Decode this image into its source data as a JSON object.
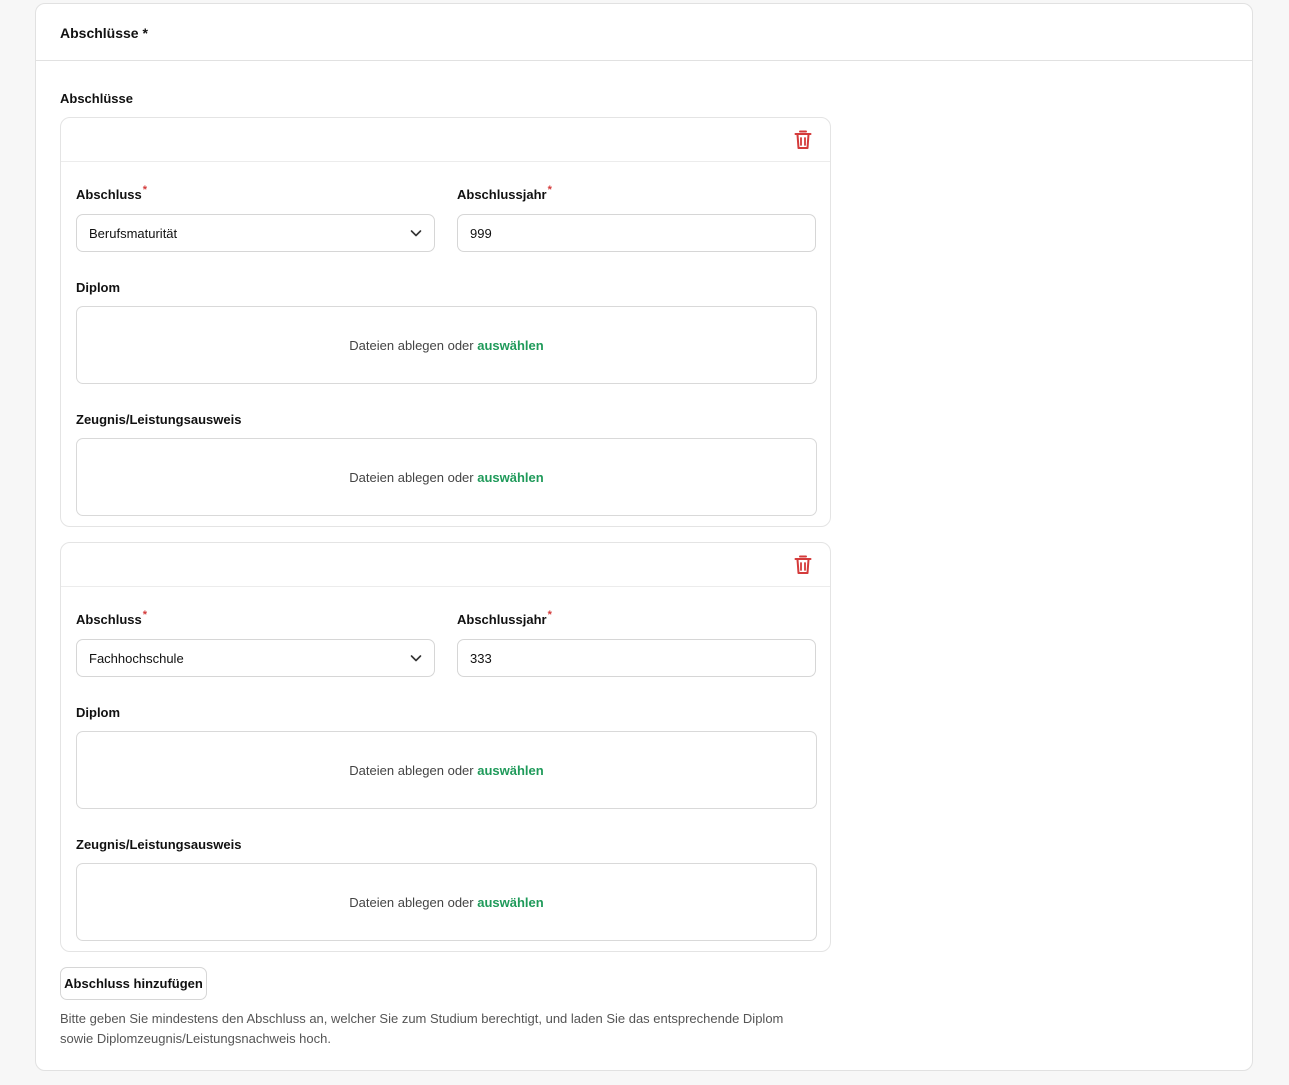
{
  "panel": {
    "title": "Abschlüsse *"
  },
  "section_label": "Abschlüsse",
  "cards": [
    {
      "degree_label": "Abschluss",
      "degree_value": "Berufsmaturität",
      "year_label": "Abschlussjahr",
      "year_value": "999",
      "diploma_label": "Diplom",
      "diploma_drop_text": "Dateien ablegen oder ",
      "diploma_drop_link": "auswählen",
      "transcript_label": "Zeugnis/Leistungsausweis",
      "transcript_drop_text": "Dateien ablegen oder ",
      "transcript_drop_link": "auswählen",
      "required_marker": "*"
    },
    {
      "degree_label": "Abschluss",
      "degree_value": "Fachhochschule",
      "year_label": "Abschlussjahr",
      "year_value": "333",
      "diploma_label": "Diplom",
      "diploma_drop_text": "Dateien ablegen oder ",
      "diploma_drop_link": "auswählen",
      "transcript_label": "Zeugnis/Leistungsausweis",
      "transcript_drop_text": "Dateien ablegen oder ",
      "transcript_drop_link": "auswählen",
      "required_marker": "*"
    }
  ],
  "add_button_label": "Abschluss hinzufügen",
  "hint_text": "Bitte geben Sie mindestens den Abschluss an, welcher Sie zum Studium berechtigt, und laden Sie das entsprechende Diplom sowie Diplomzeugnis/Leistungsnachweis hoch.",
  "colors": {
    "accent_link": "#1f9a5a",
    "delete_icon": "#d43b3b",
    "required": "#d43b3b"
  },
  "icons": {
    "delete": "trash-icon",
    "dropdown": "chevron-down-icon"
  }
}
